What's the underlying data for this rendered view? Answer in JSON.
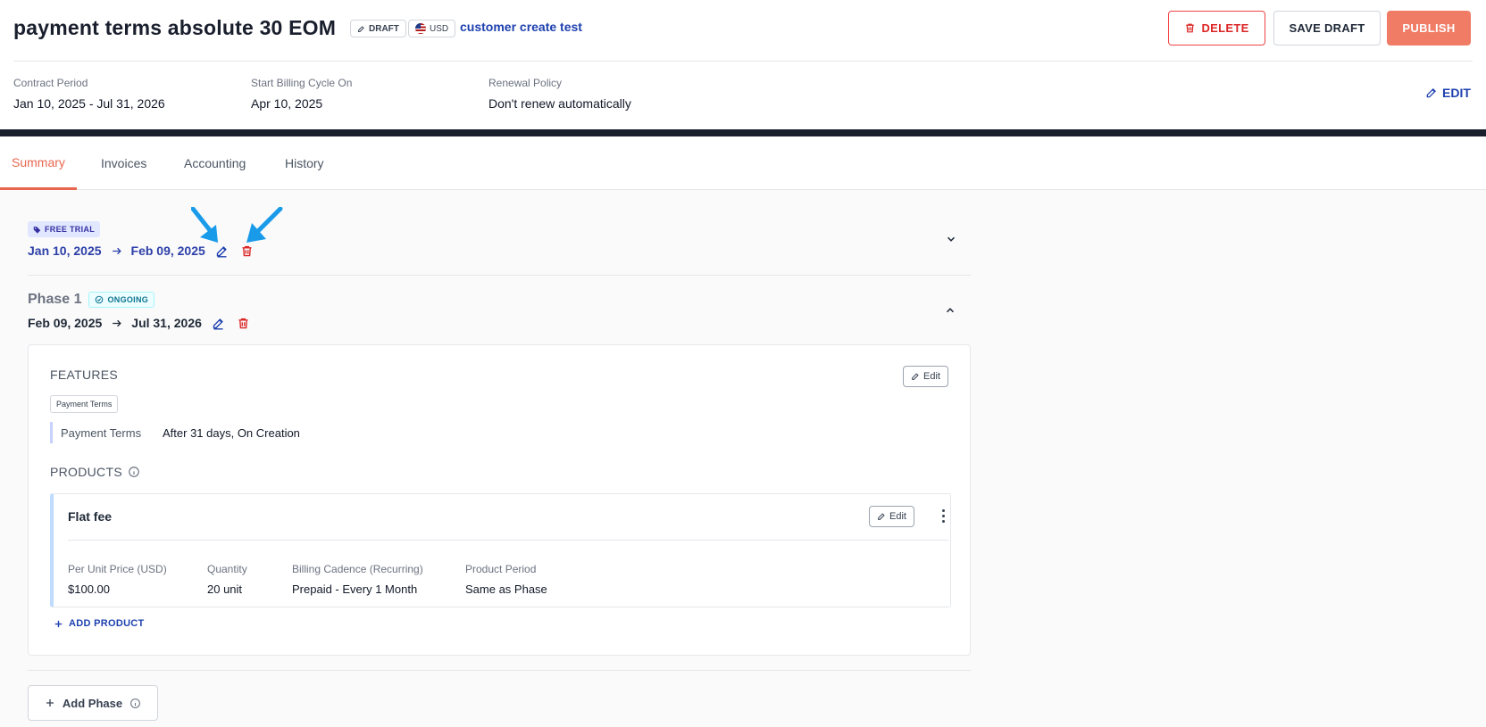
{
  "header": {
    "title": "payment terms absolute 30 EOM",
    "draft_badge": "DRAFT",
    "currency_badge": "USD",
    "customer_link": "customer create test",
    "delete_label": "DELETE",
    "save_draft_label": "SAVE DRAFT",
    "publish_label": "PUBLISH",
    "edit_label": "EDIT"
  },
  "meta": {
    "contract_period_label": "Contract Period",
    "contract_period_value": "Jan 10, 2025 - Jul 31, 2026",
    "start_billing_label": "Start Billing Cycle On",
    "start_billing_value": "Apr 10, 2025",
    "renewal_label": "Renewal Policy",
    "renewal_value": "Don't renew automatically"
  },
  "tabs": [
    {
      "label": "Summary",
      "active": true
    },
    {
      "label": "Invoices",
      "active": false
    },
    {
      "label": "Accounting",
      "active": false
    },
    {
      "label": "History",
      "active": false
    }
  ],
  "trial": {
    "badge": "FREE TRIAL",
    "start": "Jan 10, 2025",
    "end": "Feb 09, 2025"
  },
  "phase": {
    "title": "Phase 1",
    "status": "ONGOING",
    "start": "Feb 09, 2025",
    "end": "Jul 31, 2026",
    "features_title": "FEATURES",
    "edit_label": "Edit",
    "feature_tag": "Payment Terms",
    "feature_label": "Payment Terms",
    "feature_value": "After 31 days, On Creation",
    "products_title": "PRODUCTS",
    "product": {
      "name": "Flat fee",
      "edit_label": "Edit",
      "price_label": "Per Unit Price (USD)",
      "price_value": "$100.00",
      "quantity_label": "Quantity",
      "quantity_value": "20 unit",
      "cadence_label": "Billing Cadence (Recurring)",
      "cadence_value": "Prepaid - Every 1 Month",
      "period_label": "Product Period",
      "period_value": "Same as Phase"
    },
    "add_product_label": "ADD PRODUCT"
  },
  "add_phase_label": "Add Phase",
  "colors": {
    "accent": "#e8664f",
    "link": "#1e40af",
    "danger": "#dc2626",
    "annotation_arrow": "#1a9bea"
  },
  "icons": [
    "pencil-icon",
    "flag-icon",
    "trash-icon",
    "tag-icon",
    "arrow-right-icon",
    "chevron-down-icon",
    "chevron-up-icon",
    "check-circle-icon",
    "info-icon",
    "plus-icon",
    "more-vertical-icon"
  ]
}
